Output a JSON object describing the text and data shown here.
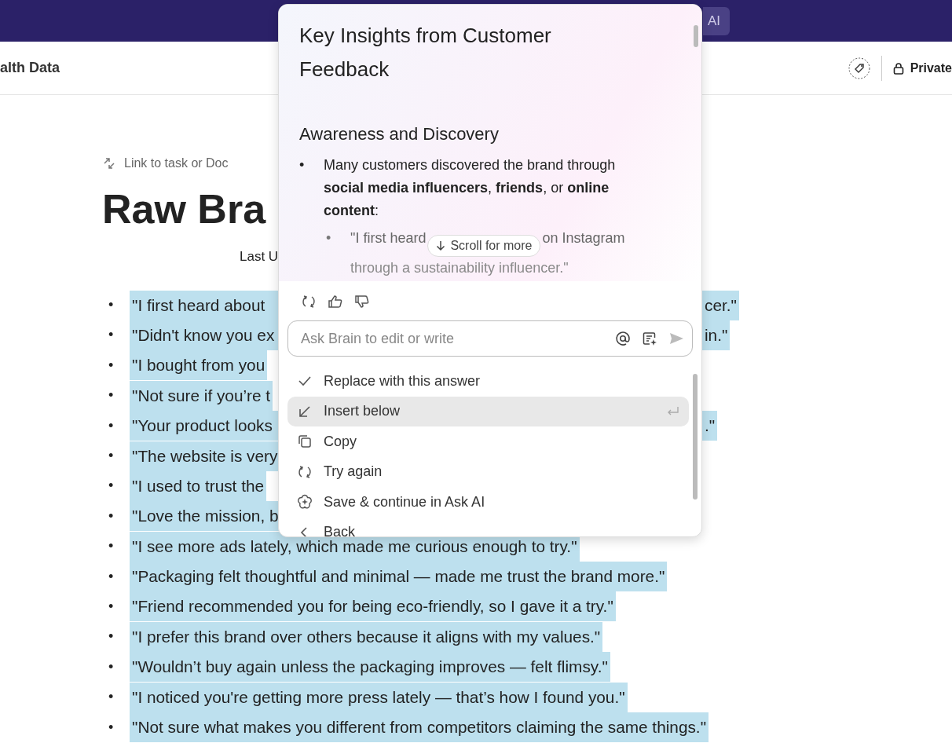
{
  "top_bar": {
    "ai_button": "AI"
  },
  "header": {
    "breadcrumb": "alth Data",
    "privacy": "Private"
  },
  "document": {
    "link_action": "Link to task or Doc",
    "title": "Raw Bra",
    "last_updated": "Last U",
    "items": [
      {
        "marker": "•",
        "left": "\"I first heard about",
        "right": "cer.\""
      },
      {
        "marker": "•",
        "left": "\"Didn't know you ex",
        "right": "in.\""
      },
      {
        "marker": "•",
        "left": "\"I bought from you"
      },
      {
        "marker": "•",
        "left": "\"Not sure if you’re t"
      },
      {
        "marker": "•",
        "left": "\"Your product looks",
        "right": ".\""
      },
      {
        "marker": "•",
        "left": "\"The website is very"
      },
      {
        "marker": "•",
        "left": "\"I used to trust the"
      },
      {
        "marker": "•",
        "left": "\"Love the mission, b"
      },
      {
        "marker": "•",
        "left": "\"I see more ads lately, which made me curious enough to try.\""
      },
      {
        "marker": "•",
        "left": "\"Packaging felt thoughtful and minimal — made me trust the brand more.\""
      },
      {
        "marker": "•",
        "left": "\"Friend recommended you for being eco-friendly, so I gave it a try.\""
      },
      {
        "marker": "•",
        "left": "\"I prefer this brand over others because it aligns with my values.\""
      },
      {
        "marker": "•",
        "left": "\"Wouldn’t buy again unless the packaging improves — felt flimsy.\""
      },
      {
        "marker": "•",
        "left": "\"I noticed you're getting more press lately — that’s how I found you.\""
      },
      {
        "marker": "•",
        "left": "\"Not sure what makes you different from competitors claiming the same things.\""
      }
    ]
  },
  "ai_panel": {
    "title": "Key Insights from Customer Feedback",
    "section_heading": "Awareness and Discovery",
    "bullets": [
      {
        "marker": "•",
        "text": "Many customers discovered the brand through **social media influencers**, **friends**, or **online content**:",
        "children": [
          {
            "marker": "•",
            "text_start": "\"I first heard",
            "text_end": "on Instagram",
            "continuation": "through a sustainability influencer.\""
          }
        ]
      }
    ],
    "scroll_hint": "Scroll for more",
    "input": {
      "placeholder": "Ask Brain to edit or write"
    },
    "menu": [
      {
        "kind": "check",
        "label": "Replace with this answer",
        "selected": false
      },
      {
        "kind": "insert",
        "label": "Insert below",
        "selected": true
      },
      {
        "kind": "copy",
        "label": "Copy",
        "selected": false
      },
      {
        "kind": "retry",
        "label": "Try again",
        "selected": false
      },
      {
        "kind": "sparkle",
        "label": "Save & continue in Ask AI",
        "selected": false
      },
      {
        "kind": "back",
        "label": "Back",
        "selected": false
      }
    ]
  }
}
